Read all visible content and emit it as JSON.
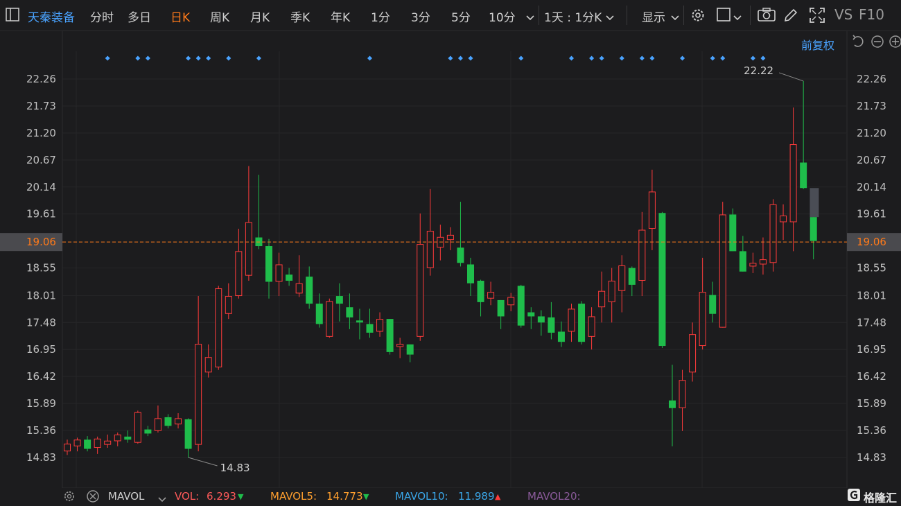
{
  "toolbar": {
    "stock_name": "天秦装备",
    "periods": [
      "分时",
      "多日",
      "日K",
      "周K",
      "月K",
      "季K",
      "年K",
      "1分",
      "3分",
      "5分",
      "10分"
    ],
    "active_period": "日K",
    "timeframe_select": "1天 : 1分K",
    "display_menu": "显示",
    "vs_label": "VS",
    "f10_label": "F10"
  },
  "sub_toolbar": {
    "adjust_label": "前复权"
  },
  "colors": {
    "up": "#ff3b3b",
    "down": "#1fbd4b",
    "accent": "#ff7a1a",
    "blue": "#4aa3ff",
    "bg": "#1c1c1e"
  },
  "chart_data": {
    "type": "candlestick",
    "y_ticks": [
      "22.26",
      "21.73",
      "21.20",
      "20.67",
      "20.14",
      "19.61",
      "19.06",
      "18.55",
      "18.01",
      "17.48",
      "16.95",
      "16.42",
      "15.89",
      "15.36",
      "14.83"
    ],
    "ylim": [
      14.83,
      22.26
    ],
    "current_price": "19.06",
    "max_label": "22.22",
    "min_label": "14.83",
    "candles": [
      {
        "o": 14.95,
        "c": 15.1,
        "h": 15.18,
        "l": 14.88
      },
      {
        "o": 15.05,
        "c": 15.18,
        "h": 15.22,
        "l": 14.95
      },
      {
        "o": 15.18,
        "c": 15.0,
        "h": 15.25,
        "l": 14.95
      },
      {
        "o": 15.02,
        "c": 15.2,
        "h": 15.24,
        "l": 14.9
      },
      {
        "o": 15.08,
        "c": 15.16,
        "h": 15.28,
        "l": 15.02
      },
      {
        "o": 15.15,
        "c": 15.28,
        "h": 15.32,
        "l": 15.05
      },
      {
        "o": 15.24,
        "c": 15.18,
        "h": 15.36,
        "l": 15.12
      },
      {
        "o": 15.12,
        "c": 15.72,
        "h": 15.75,
        "l": 15.1
      },
      {
        "o": 15.38,
        "c": 15.3,
        "h": 15.45,
        "l": 15.25
      },
      {
        "o": 15.35,
        "c": 15.6,
        "h": 15.85,
        "l": 15.32
      },
      {
        "o": 15.62,
        "c": 15.45,
        "h": 15.68,
        "l": 15.4
      },
      {
        "o": 15.48,
        "c": 15.6,
        "h": 15.7,
        "l": 15.4
      },
      {
        "o": 15.58,
        "c": 15.0,
        "h": 15.6,
        "l": 14.83
      },
      {
        "o": 15.08,
        "c": 17.06,
        "h": 18.0,
        "l": 14.95
      },
      {
        "o": 16.5,
        "c": 16.8,
        "h": 17.05,
        "l": 16.4
      },
      {
        "o": 16.6,
        "c": 18.15,
        "h": 18.2,
        "l": 16.55
      },
      {
        "o": 17.65,
        "c": 18.0,
        "h": 18.25,
        "l": 17.55
      },
      {
        "o": 18.0,
        "c": 18.88,
        "h": 19.32,
        "l": 17.95
      },
      {
        "o": 18.4,
        "c": 19.45,
        "h": 20.55,
        "l": 18.3
      },
      {
        "o": 19.15,
        "c": 18.98,
        "h": 20.38,
        "l": 18.92
      },
      {
        "o": 18.98,
        "c": 18.28,
        "h": 19.12,
        "l": 17.95
      },
      {
        "o": 18.28,
        "c": 18.62,
        "h": 18.85,
        "l": 18.0
      },
      {
        "o": 18.42,
        "c": 18.3,
        "h": 18.55,
        "l": 18.2
      },
      {
        "o": 18.05,
        "c": 18.25,
        "h": 18.8,
        "l": 17.98
      },
      {
        "o": 18.38,
        "c": 17.85,
        "h": 18.58,
        "l": 17.75
      },
      {
        "o": 17.85,
        "c": 17.45,
        "h": 18.05,
        "l": 17.38
      },
      {
        "o": 17.2,
        "c": 17.9,
        "h": 17.95,
        "l": 17.18
      },
      {
        "o": 18.0,
        "c": 17.85,
        "h": 18.25,
        "l": 17.5
      },
      {
        "o": 17.78,
        "c": 17.58,
        "h": 18.05,
        "l": 17.35
      },
      {
        "o": 17.52,
        "c": 17.48,
        "h": 17.75,
        "l": 17.15
      },
      {
        "o": 17.45,
        "c": 17.28,
        "h": 17.75,
        "l": 17.18
      },
      {
        "o": 17.3,
        "c": 17.55,
        "h": 17.68,
        "l": 17.2
      },
      {
        "o": 17.55,
        "c": 16.9,
        "h": 17.55,
        "l": 16.85
      },
      {
        "o": 17.0,
        "c": 17.06,
        "h": 17.18,
        "l": 16.78
      },
      {
        "o": 17.05,
        "c": 16.85,
        "h": 17.05,
        "l": 16.7
      },
      {
        "o": 17.2,
        "c": 19.02,
        "h": 19.62,
        "l": 17.12
      },
      {
        "o": 18.55,
        "c": 19.28,
        "h": 20.1,
        "l": 18.4
      },
      {
        "o": 18.95,
        "c": 19.16,
        "h": 19.4,
        "l": 18.7
      },
      {
        "o": 19.1,
        "c": 19.2,
        "h": 19.35,
        "l": 18.9
      },
      {
        "o": 18.95,
        "c": 18.65,
        "h": 19.85,
        "l": 18.58
      },
      {
        "o": 18.62,
        "c": 18.25,
        "h": 18.75,
        "l": 18.0
      },
      {
        "o": 18.3,
        "c": 17.88,
        "h": 18.32,
        "l": 17.6
      },
      {
        "o": 17.95,
        "c": 18.08,
        "h": 18.28,
        "l": 17.82
      },
      {
        "o": 17.92,
        "c": 17.6,
        "h": 17.92,
        "l": 17.35
      },
      {
        "o": 17.82,
        "c": 17.98,
        "h": 18.06,
        "l": 17.7
      },
      {
        "o": 18.2,
        "c": 17.42,
        "h": 18.22,
        "l": 17.38
      },
      {
        "o": 17.68,
        "c": 17.6,
        "h": 17.78,
        "l": 17.35
      },
      {
        "o": 17.6,
        "c": 17.48,
        "h": 17.72,
        "l": 17.22
      },
      {
        "o": 17.58,
        "c": 17.28,
        "h": 17.88,
        "l": 17.15
      },
      {
        "o": 17.3,
        "c": 17.1,
        "h": 17.5,
        "l": 17.0
      },
      {
        "o": 17.3,
        "c": 17.75,
        "h": 17.85,
        "l": 17.1
      },
      {
        "o": 17.85,
        "c": 17.1,
        "h": 17.9,
        "l": 17.05
      },
      {
        "o": 17.2,
        "c": 17.6,
        "h": 17.78,
        "l": 16.95
      },
      {
        "o": 17.78,
        "c": 18.1,
        "h": 18.48,
        "l": 17.48
      },
      {
        "o": 17.88,
        "c": 18.3,
        "h": 18.55,
        "l": 17.48
      },
      {
        "o": 18.1,
        "c": 18.6,
        "h": 18.8,
        "l": 17.68
      },
      {
        "o": 18.55,
        "c": 18.22,
        "h": 18.58,
        "l": 18.0
      },
      {
        "o": 18.3,
        "c": 19.3,
        "h": 19.65,
        "l": 18.0
      },
      {
        "o": 19.32,
        "c": 20.05,
        "h": 20.48,
        "l": 18.9
      },
      {
        "o": 19.63,
        "c": 17.02,
        "h": 19.65,
        "l": 16.98
      },
      {
        "o": 15.95,
        "c": 15.8,
        "h": 16.65,
        "l": 15.05
      },
      {
        "o": 15.8,
        "c": 16.35,
        "h": 16.55,
        "l": 15.35
      },
      {
        "o": 16.5,
        "c": 17.25,
        "h": 17.48,
        "l": 16.32
      },
      {
        "o": 17.02,
        "c": 18.08,
        "h": 18.75,
        "l": 16.95
      },
      {
        "o": 18.02,
        "c": 17.65,
        "h": 18.28,
        "l": 17.48
      },
      {
        "o": 17.38,
        "c": 19.6,
        "h": 19.85,
        "l": 17.38
      },
      {
        "o": 19.6,
        "c": 18.88,
        "h": 19.72,
        "l": 18.88
      },
      {
        "o": 18.88,
        "c": 18.48,
        "h": 19.18,
        "l": 18.48
      },
      {
        "o": 18.58,
        "c": 18.65,
        "h": 18.85,
        "l": 18.45
      },
      {
        "o": 18.62,
        "c": 18.72,
        "h": 19.15,
        "l": 18.42
      },
      {
        "o": 18.65,
        "c": 19.8,
        "h": 19.9,
        "l": 18.48
      },
      {
        "o": 19.45,
        "c": 19.58,
        "h": 19.8,
        "l": 19.1
      },
      {
        "o": 19.45,
        "c": 20.98,
        "h": 21.7,
        "l": 18.88
      },
      {
        "o": 20.62,
        "c": 20.12,
        "h": 22.22,
        "l": 20.1
      },
      {
        "o": 19.55,
        "c": 19.08,
        "h": 19.62,
        "l": 18.72
      }
    ],
    "gap_fill_candle_index": 73,
    "marker_candle_indices": [
      4,
      7,
      8,
      12,
      13,
      14,
      16,
      19,
      30,
      38,
      39,
      40,
      45,
      50,
      52,
      53,
      55,
      57,
      58,
      61,
      64,
      65,
      68,
      69
    ]
  },
  "volume_bar": {
    "indicator": "MAVOL",
    "items": [
      {
        "label": "VOL:",
        "value": "6.293",
        "arrow": "▼",
        "color": "#ff5a5a",
        "arrow_color": "#1fbd4b"
      },
      {
        "label": "MAVOL5:",
        "value": "14.773",
        "arrow": "▼",
        "color": "#ff9f2e",
        "arrow_color": "#1fbd4b"
      },
      {
        "label": "MAVOL10:",
        "value": "11.989",
        "arrow": "▲",
        "color": "#3aa6e8",
        "arrow_color": "#ff3b3b"
      },
      {
        "label": "MAVOL20:",
        "value": "",
        "arrow": "",
        "color": "#8a5a9a",
        "arrow_color": "#8a5a9a"
      }
    ]
  },
  "watermark": "格隆汇"
}
